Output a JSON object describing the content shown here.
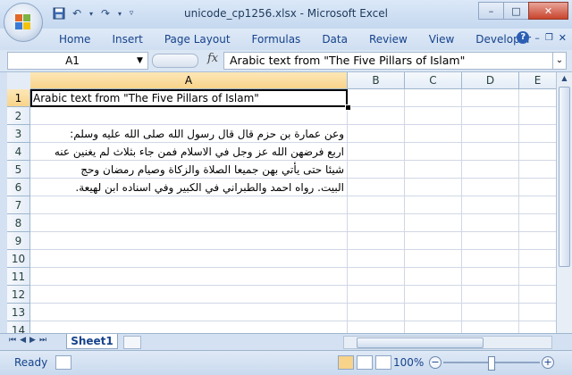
{
  "window": {
    "title": "unicode_cp1256.xlsx - Microsoft Excel",
    "minimize": "–",
    "restore": "□",
    "close": "✕"
  },
  "ribbon": {
    "tabs": [
      "Home",
      "Insert",
      "Page Layout",
      "Formulas",
      "Data",
      "Review",
      "View",
      "Developer"
    ]
  },
  "formula_bar": {
    "name_box": "A1",
    "fx": "fx",
    "content": "Arabic text from \"The Five Pillars of Islam\""
  },
  "grid": {
    "columns": [
      "A",
      "B",
      "C",
      "D",
      "E"
    ],
    "rows": [
      "1",
      "2",
      "3",
      "4",
      "5",
      "6",
      "7",
      "8",
      "9",
      "10",
      "11",
      "12",
      "13",
      "14"
    ],
    "selected_cell": "A1",
    "cells": {
      "A1": "Arabic text from \"The Five Pillars of Islam\"",
      "A3": "وعن عمارة بن حزم قال قال رسول الله صلى الله عليه وسلم:",
      "A4": "اربع فرضهن الله عز وجل في الاسلام فمن جاء بثلاث لم يغنين عنه",
      "A5": "شيئا حتى يأتي بهن جميعا الصلاة والزكاة وصيام رمضان وحج",
      "A6": "البيت. رواه احمد والطبراني في الكبير وفي اسناده ابن لهيعة."
    }
  },
  "sheets": {
    "tabs": [
      "Sheet1"
    ]
  },
  "status": {
    "ready": "Ready",
    "zoom": "100%"
  },
  "colors": {
    "accent": "#15428b",
    "selection": "#f8d38a"
  }
}
